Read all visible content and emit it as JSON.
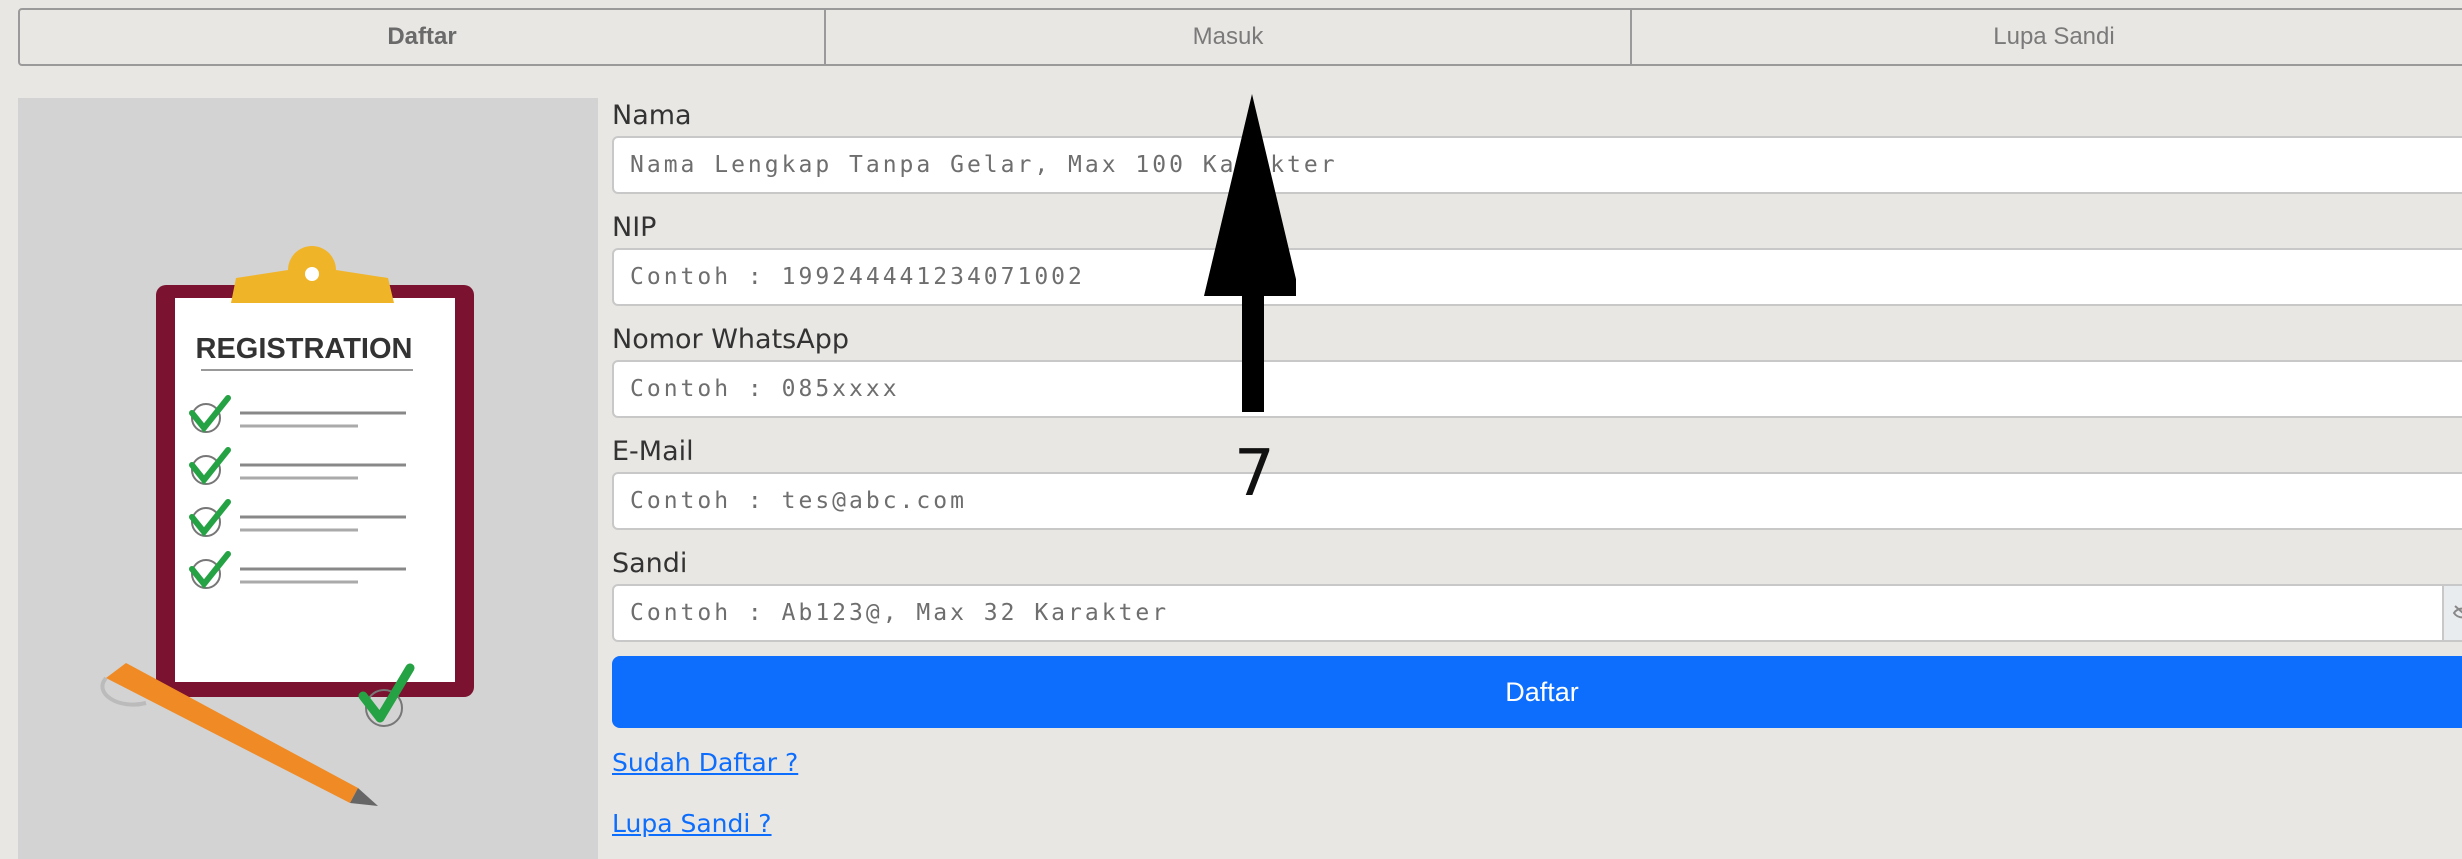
{
  "tabs": [
    {
      "label": "Daftar",
      "active": true
    },
    {
      "label": "Masuk",
      "active": false
    },
    {
      "label": "Lupa Sandi",
      "active": false
    }
  ],
  "illustration": {
    "title": "REGISTRATION",
    "icon": "clipboard-checklist-icon"
  },
  "form": {
    "fields": [
      {
        "label": "Nama",
        "placeholder": "Nama Lengkap Tanpa Gelar, Max 100 Karakter"
      },
      {
        "label": "NIP",
        "placeholder": "Contoh : 199244441234071002"
      },
      {
        "label": "Nomor WhatsApp",
        "placeholder": "Contoh : 085xxxx"
      },
      {
        "label": "E-Mail",
        "placeholder": "Contoh : tes@abc.com"
      },
      {
        "label": "Sandi",
        "placeholder": "Contoh : Ab123@, Max 32 Karakter"
      }
    ],
    "submit_label": "Daftar",
    "links": {
      "already_registered": "Sudah Daftar ?",
      "forgot_password": "Lupa Sandi ?"
    }
  },
  "annotation": {
    "label": "7"
  },
  "colors": {
    "primary": "#0d6efd",
    "background": "#e9e7e3",
    "panel": "#d3d3d3"
  }
}
